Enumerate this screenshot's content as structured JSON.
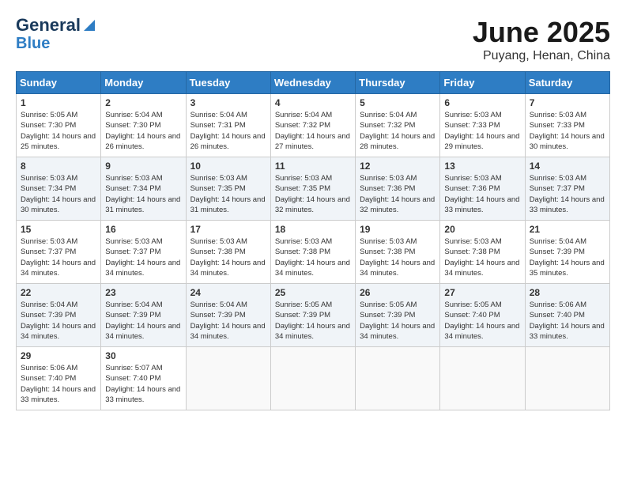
{
  "header": {
    "logo_line1": "General",
    "logo_line2": "Blue",
    "title": "June 2025",
    "subtitle": "Puyang, Henan, China"
  },
  "days_of_week": [
    "Sunday",
    "Monday",
    "Tuesday",
    "Wednesday",
    "Thursday",
    "Friday",
    "Saturday"
  ],
  "weeks": [
    [
      {
        "day": "1",
        "sunrise": "5:05 AM",
        "sunset": "7:30 PM",
        "daylight": "14 hours and 25 minutes."
      },
      {
        "day": "2",
        "sunrise": "5:04 AM",
        "sunset": "7:30 PM",
        "daylight": "14 hours and 26 minutes."
      },
      {
        "day": "3",
        "sunrise": "5:04 AM",
        "sunset": "7:31 PM",
        "daylight": "14 hours and 26 minutes."
      },
      {
        "day": "4",
        "sunrise": "5:04 AM",
        "sunset": "7:32 PM",
        "daylight": "14 hours and 27 minutes."
      },
      {
        "day": "5",
        "sunrise": "5:04 AM",
        "sunset": "7:32 PM",
        "daylight": "14 hours and 28 minutes."
      },
      {
        "day": "6",
        "sunrise": "5:03 AM",
        "sunset": "7:33 PM",
        "daylight": "14 hours and 29 minutes."
      },
      {
        "day": "7",
        "sunrise": "5:03 AM",
        "sunset": "7:33 PM",
        "daylight": "14 hours and 30 minutes."
      }
    ],
    [
      {
        "day": "8",
        "sunrise": "5:03 AM",
        "sunset": "7:34 PM",
        "daylight": "14 hours and 30 minutes."
      },
      {
        "day": "9",
        "sunrise": "5:03 AM",
        "sunset": "7:34 PM",
        "daylight": "14 hours and 31 minutes."
      },
      {
        "day": "10",
        "sunrise": "5:03 AM",
        "sunset": "7:35 PM",
        "daylight": "14 hours and 31 minutes."
      },
      {
        "day": "11",
        "sunrise": "5:03 AM",
        "sunset": "7:35 PM",
        "daylight": "14 hours and 32 minutes."
      },
      {
        "day": "12",
        "sunrise": "5:03 AM",
        "sunset": "7:36 PM",
        "daylight": "14 hours and 32 minutes."
      },
      {
        "day": "13",
        "sunrise": "5:03 AM",
        "sunset": "7:36 PM",
        "daylight": "14 hours and 33 minutes."
      },
      {
        "day": "14",
        "sunrise": "5:03 AM",
        "sunset": "7:37 PM",
        "daylight": "14 hours and 33 minutes."
      }
    ],
    [
      {
        "day": "15",
        "sunrise": "5:03 AM",
        "sunset": "7:37 PM",
        "daylight": "14 hours and 34 minutes."
      },
      {
        "day": "16",
        "sunrise": "5:03 AM",
        "sunset": "7:37 PM",
        "daylight": "14 hours and 34 minutes."
      },
      {
        "day": "17",
        "sunrise": "5:03 AM",
        "sunset": "7:38 PM",
        "daylight": "14 hours and 34 minutes."
      },
      {
        "day": "18",
        "sunrise": "5:03 AM",
        "sunset": "7:38 PM",
        "daylight": "14 hours and 34 minutes."
      },
      {
        "day": "19",
        "sunrise": "5:03 AM",
        "sunset": "7:38 PM",
        "daylight": "14 hours and 34 minutes."
      },
      {
        "day": "20",
        "sunrise": "5:03 AM",
        "sunset": "7:38 PM",
        "daylight": "14 hours and 34 minutes."
      },
      {
        "day": "21",
        "sunrise": "5:04 AM",
        "sunset": "7:39 PM",
        "daylight": "14 hours and 35 minutes."
      }
    ],
    [
      {
        "day": "22",
        "sunrise": "5:04 AM",
        "sunset": "7:39 PM",
        "daylight": "14 hours and 34 minutes."
      },
      {
        "day": "23",
        "sunrise": "5:04 AM",
        "sunset": "7:39 PM",
        "daylight": "14 hours and 34 minutes."
      },
      {
        "day": "24",
        "sunrise": "5:04 AM",
        "sunset": "7:39 PM",
        "daylight": "14 hours and 34 minutes."
      },
      {
        "day": "25",
        "sunrise": "5:05 AM",
        "sunset": "7:39 PM",
        "daylight": "14 hours and 34 minutes."
      },
      {
        "day": "26",
        "sunrise": "5:05 AM",
        "sunset": "7:39 PM",
        "daylight": "14 hours and 34 minutes."
      },
      {
        "day": "27",
        "sunrise": "5:05 AM",
        "sunset": "7:40 PM",
        "daylight": "14 hours and 34 minutes."
      },
      {
        "day": "28",
        "sunrise": "5:06 AM",
        "sunset": "7:40 PM",
        "daylight": "14 hours and 33 minutes."
      }
    ],
    [
      {
        "day": "29",
        "sunrise": "5:06 AM",
        "sunset": "7:40 PM",
        "daylight": "14 hours and 33 minutes."
      },
      {
        "day": "30",
        "sunrise": "5:07 AM",
        "sunset": "7:40 PM",
        "daylight": "14 hours and 33 minutes."
      },
      {
        "day": "",
        "sunrise": "",
        "sunset": "",
        "daylight": ""
      },
      {
        "day": "",
        "sunrise": "",
        "sunset": "",
        "daylight": ""
      },
      {
        "day": "",
        "sunrise": "",
        "sunset": "",
        "daylight": ""
      },
      {
        "day": "",
        "sunrise": "",
        "sunset": "",
        "daylight": ""
      },
      {
        "day": "",
        "sunrise": "",
        "sunset": "",
        "daylight": ""
      }
    ]
  ]
}
